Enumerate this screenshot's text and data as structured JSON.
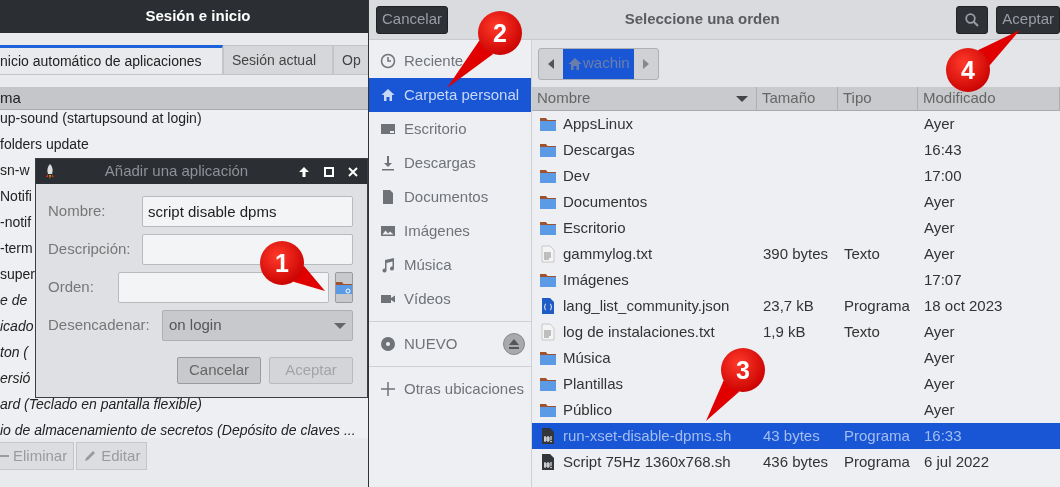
{
  "session_window": {
    "title": "Sesión e inicio",
    "tabs": [
      {
        "label": "nicio automático de aplicaciones",
        "selected": true
      },
      {
        "label": "Sesión actual",
        "selected": false
      },
      {
        "label": "Op",
        "selected": false
      }
    ],
    "table": {
      "columns": [
        "ma"
      ],
      "rows": [
        {
          "text": "up-sound (startupsound at login)",
          "italic": false
        },
        {
          "text": "folders update",
          "italic": false
        },
        {
          "text": "sn-w",
          "italic": false
        },
        {
          "text": "Notifi",
          "italic": false
        },
        {
          "text": "-notif",
          "italic": false
        },
        {
          "text": "-term",
          "italic": false
        },
        {
          "text": "super",
          "italic": false
        },
        {
          "text": "e de",
          "italic": true
        },
        {
          "text": "icado",
          "italic": true
        },
        {
          "text": "ton (",
          "italic": true
        },
        {
          "text": "ersió",
          "italic": true
        },
        {
          "text": "ard (Teclado en pantalla flexible)",
          "italic": true
        },
        {
          "text": "io de almacenamiento de secretos (Depósito de claves ...",
          "italic": true
        }
      ]
    },
    "buttons": [
      {
        "label": "Eliminar",
        "kind": "remove",
        "disabled": true
      },
      {
        "label": "Editar",
        "kind": "edit",
        "disabled": true
      }
    ]
  },
  "dialog": {
    "title": "Añadir una aplicación",
    "fields": [
      {
        "label": "Nombre:",
        "kind": "text",
        "value": "script disable dpms"
      },
      {
        "label": "Descripción:",
        "kind": "text"
      },
      {
        "label": "Orden:",
        "kind": "file"
      },
      {
        "label": "Desencadenar:",
        "kind": "select",
        "value": "on login"
      }
    ],
    "buttons": [
      {
        "label": "Cancelar",
        "disabled": false
      },
      {
        "label": "Aceptar",
        "disabled": true
      }
    ]
  },
  "file_chooser": {
    "title": "Seleccione una orden",
    "cancel": "Cancelar",
    "accept": "Aceptar",
    "sidebar": {
      "places": [
        {
          "label": "Reciente",
          "kind": "clock",
          "selected": false
        },
        {
          "label": "Carpeta personal",
          "kind": "home",
          "selected": true
        },
        {
          "label": "Escritorio",
          "kind": "desktop",
          "selected": false
        },
        {
          "label": "Descargas",
          "kind": "download",
          "selected": false
        },
        {
          "label": "Documentos",
          "kind": "document",
          "selected": false
        },
        {
          "label": "Imágenes",
          "kind": "image",
          "selected": false
        },
        {
          "label": "Música",
          "kind": "music",
          "selected": false
        },
        {
          "label": "Vídeos",
          "kind": "video",
          "selected": false
        }
      ],
      "devices": [
        {
          "label": "NUEVO",
          "kind": "disc"
        }
      ],
      "other": [
        {
          "label": "Otras ubicaciones",
          "kind": "plus"
        }
      ]
    },
    "path": [
      {
        "label": "wachin",
        "selected": true
      }
    ],
    "columns": [
      "Nombre",
      "Tamaño",
      "Tipo",
      "Modificado"
    ],
    "files": [
      {
        "name": "AppsLinux",
        "kind": "folder",
        "modified": "Ayer",
        "selected": false
      },
      {
        "name": "Descargas",
        "kind": "folder",
        "modified": "16:43",
        "selected": false
      },
      {
        "name": "Dev",
        "kind": "folder",
        "modified": "17:00",
        "selected": false
      },
      {
        "name": "Documentos",
        "kind": "folder",
        "modified": "Ayer",
        "selected": false
      },
      {
        "name": "Escritorio",
        "kind": "folder",
        "modified": "Ayer",
        "selected": false
      },
      {
        "name": "gammylog.txt",
        "kind": "text",
        "size": "390 bytes",
        "type": "Texto",
        "modified": "Ayer",
        "selected": false
      },
      {
        "name": "Imágenes",
        "kind": "folder",
        "modified": "17:07",
        "selected": false
      },
      {
        "name": "lang_list_community.json",
        "kind": "json",
        "size": "23,7 kB",
        "type": "Programa",
        "modified": "18 oct 2023",
        "selected": false
      },
      {
        "name": "log de instalaciones.txt",
        "kind": "text",
        "size": "1,9 kB",
        "type": "Texto",
        "modified": "Ayer",
        "selected": false
      },
      {
        "name": "Música",
        "kind": "folder",
        "modified": "Ayer",
        "selected": false
      },
      {
        "name": "Plantillas",
        "kind": "folder",
        "modified": "Ayer",
        "selected": false
      },
      {
        "name": "Público",
        "kind": "folder",
        "modified": "Ayer",
        "selected": false
      },
      {
        "name": "run-xset-disable-dpms.sh",
        "kind": "script",
        "size": "43 bytes",
        "type": "Programa",
        "modified": "16:33",
        "selected": true
      },
      {
        "name": "Script 75Hz 1360x768.sh",
        "kind": "script",
        "size": "436 bytes",
        "type": "Programa",
        "modified": "6 jul 2022",
        "selected": false
      }
    ]
  },
  "callouts": [
    {
      "number": "1"
    },
    {
      "number": "2"
    },
    {
      "number": "3"
    },
    {
      "number": "4"
    }
  ]
}
